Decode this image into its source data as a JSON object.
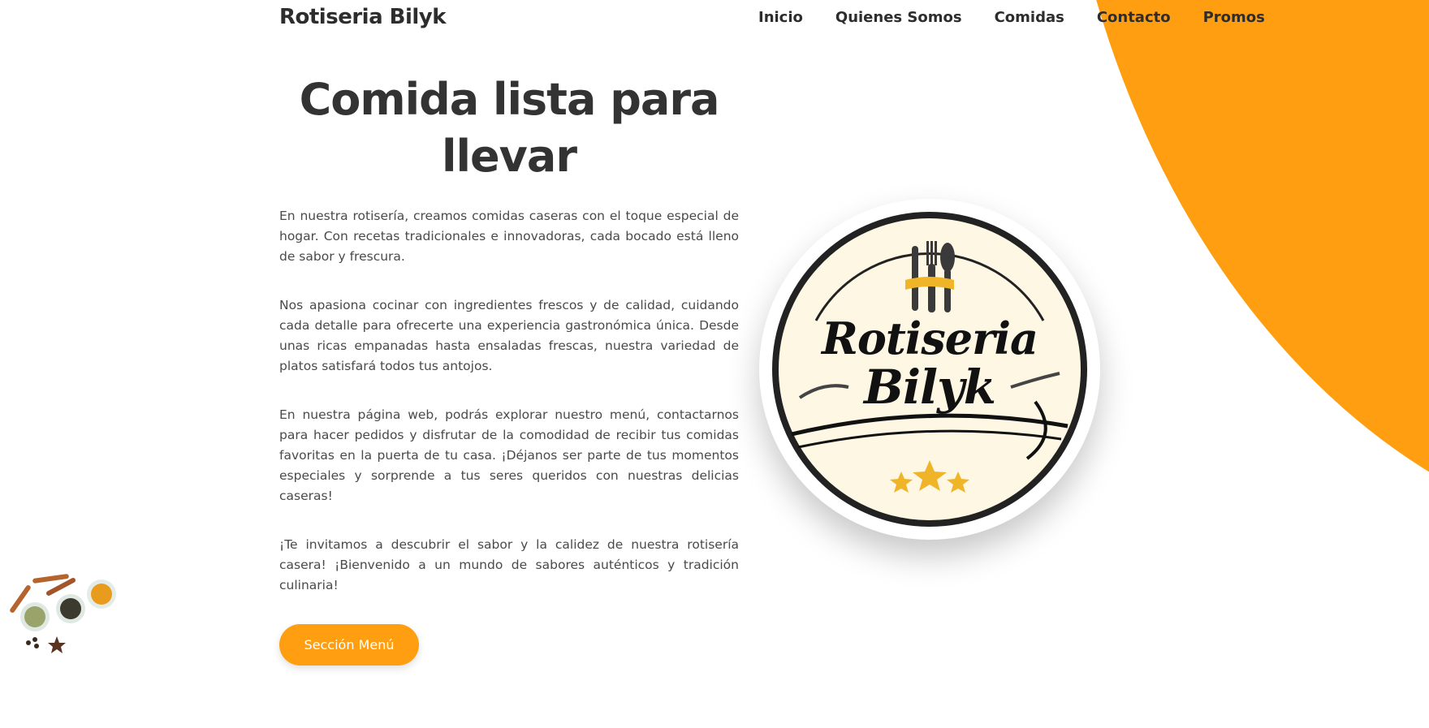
{
  "header": {
    "brand": "Rotiseria Bilyk",
    "nav": [
      "Inicio",
      "Quienes Somos",
      "Comidas",
      "Contacto",
      "Promos"
    ]
  },
  "hero": {
    "title": "Comida lista para llevar",
    "paragraphs": [
      "En nuestra rotisería, creamos comidas caseras con el toque especial de hogar. Con recetas tradicionales e innovadoras, cada bocado está lleno de sabor y frescura.",
      "Nos apasiona cocinar con ingredientes frescos y de calidad, cuidando cada detalle para ofrecerte una experiencia gastronómica única. Desde unas ricas empanadas hasta ensaladas frescas, nuestra variedad de platos satisfará todos tus antojos.",
      "En nuestra página web, podrás explorar nuestro menú, contactarnos para hacer pedidos y disfrutar de la comodidad de recibir tus comidas favoritas en la puerta de tu casa. ¡Déjanos ser parte de tus momentos especiales y sorprende a tus seres queridos con nuestras delicias caseras!",
      "¡Te invitamos a descubrir el sabor y la calidez de nuestra rotisería casera! ¡Bienvenido a un mundo de sabores auténticos y tradición culinaria!"
    ],
    "button_label": "Sección Menú"
  },
  "logo": {
    "line1": "Rotiseria",
    "line2": "Bilyk"
  },
  "colors": {
    "accent": "#fe9e10",
    "text": "#333333",
    "logo_bg": "#fdf7e3",
    "star": "#f0b429"
  },
  "icons": [
    "fork-icon",
    "knife-icon",
    "spoon-icon",
    "star-icon",
    "spices-image"
  ]
}
